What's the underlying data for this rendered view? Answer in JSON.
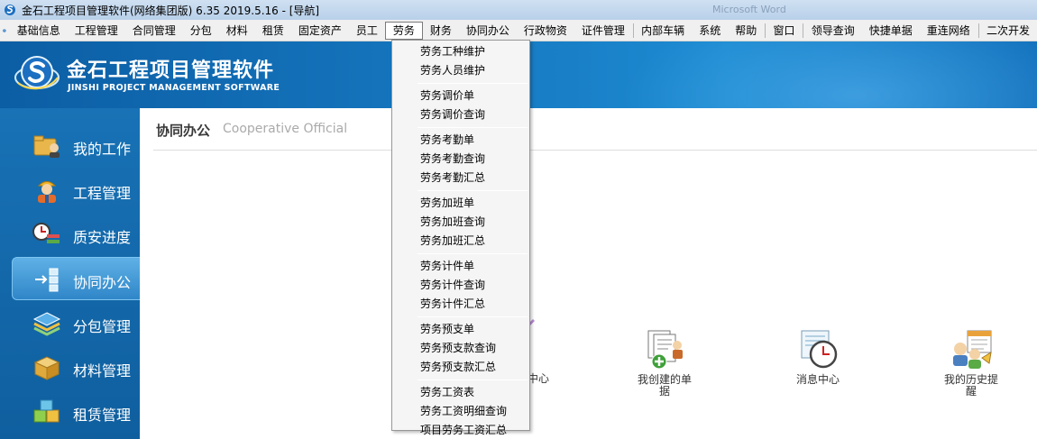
{
  "window": {
    "title": "金石工程项目管理软件(网络集团版) 6.35  2019.5.16 - [导航]",
    "ghost_title": "Microsoft Word"
  },
  "menubar": {
    "items": [
      "基础信息",
      "工程管理",
      "合同管理",
      "分包",
      "材料",
      "租赁",
      "固定资产",
      "员工",
      "劳务",
      "财务",
      "协同办公",
      "行政物资",
      "证件管理",
      "内部车辆",
      "系统",
      "帮助",
      "窗口",
      "领导查询",
      "快捷单据",
      "重连网络",
      "二次开发"
    ],
    "active_index": 8
  },
  "header": {
    "brand_cn": "金石工程项目管理软件",
    "brand_en": "JINSHI PROJECT MANAGEMENT SOFTWARE"
  },
  "sidebar": {
    "items": [
      {
        "label": "我的工作",
        "icon": "my-work-icon"
      },
      {
        "label": "工程管理",
        "icon": "worker-icon"
      },
      {
        "label": "质安进度",
        "icon": "clock-list-icon"
      },
      {
        "label": "协同办公",
        "icon": "flow-icon"
      },
      {
        "label": "分包管理",
        "icon": "stack-icon"
      },
      {
        "label": "材料管理",
        "icon": "box-icon"
      },
      {
        "label": "租赁管理",
        "icon": "cubes-icon"
      }
    ],
    "active_index": 3
  },
  "content": {
    "title": "协同办公",
    "subtitle": "Cooperative Official",
    "tiles": [
      {
        "label": "中心",
        "icon": "center-icon"
      },
      {
        "label": "我创建的单据",
        "icon": "documents-add-icon"
      },
      {
        "label": "消息中心",
        "icon": "message-clock-icon"
      },
      {
        "label": "我的历史提醒",
        "icon": "history-reminder-icon"
      }
    ]
  },
  "dropdown": {
    "groups": [
      [
        "劳务工种维护",
        "劳务人员维护"
      ],
      [
        "劳务调价单",
        "劳务调价查询"
      ],
      [
        "劳务考勤单",
        "劳务考勤查询",
        "劳务考勤汇总"
      ],
      [
        "劳务加班单",
        "劳务加班查询",
        "劳务加班汇总"
      ],
      [
        "劳务计件单",
        "劳务计件查询",
        "劳务计件汇总"
      ],
      [
        "劳务预支单",
        "劳务预支款查询",
        "劳务预支款汇总"
      ],
      [
        "劳务工资表",
        "劳务工资明细查询",
        "项目劳务工资汇总"
      ]
    ]
  },
  "colors": {
    "header_blue": "#1575bd",
    "sidebar_blue": "#1872b5",
    "active_item": "#4fa6df"
  }
}
